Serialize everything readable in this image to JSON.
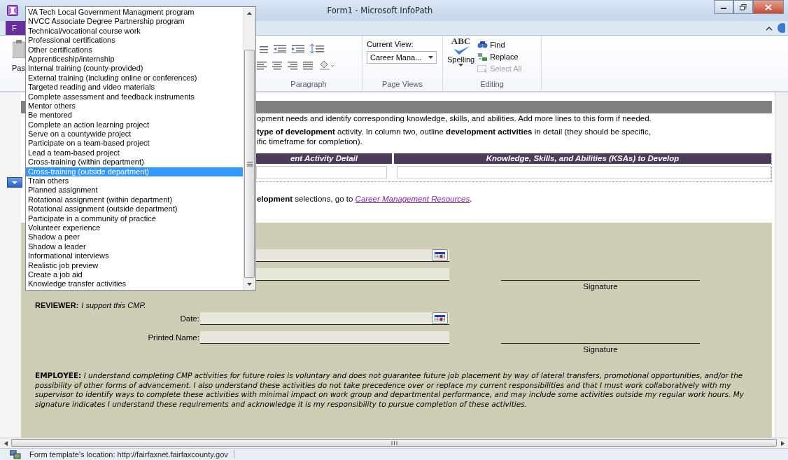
{
  "window": {
    "title": "Form1  -  Microsoft InfoPath"
  },
  "ribbon": {
    "file_tab": "F",
    "paste_label": "Pas",
    "groups": [
      {
        "kind": "paragraph",
        "label": "Paragraph"
      },
      {
        "kind": "views",
        "label": "Page Views"
      },
      {
        "kind": "editing",
        "label": "Editing"
      }
    ],
    "current_view": {
      "label": "Current View:",
      "value": "Career Mana..."
    },
    "spelling": {
      "logo": "ABC",
      "label": "Spelling"
    },
    "editing": [
      {
        "kind": "find",
        "label": "Find",
        "disabled": false
      },
      {
        "kind": "replace",
        "label": "Replace",
        "disabled": false
      },
      {
        "kind": "select",
        "label": "Select All",
        "disabled": true
      }
    ]
  },
  "dropdown": {
    "items": [
      {
        "label": "VA Tech Local Government Managment program",
        "selected": false
      },
      {
        "label": "NVCC Associate Degree Partnership program",
        "selected": false
      },
      {
        "label": "Technical/vocational course work",
        "selected": false
      },
      {
        "label": "Professional certifications",
        "selected": false
      },
      {
        "label": "Other certifications",
        "selected": false
      },
      {
        "label": "Apprenticeship/internship",
        "selected": false
      },
      {
        "label": "Internal training (county-provided)",
        "selected": false
      },
      {
        "label": "External training (including online or conferences)",
        "selected": false
      },
      {
        "label": "Targeted reading and video materials",
        "selected": false
      },
      {
        "label": "Complete assessment and feedback instruments",
        "selected": false
      },
      {
        "label": "Mentor others",
        "selected": false
      },
      {
        "label": "Be mentored",
        "selected": false
      },
      {
        "label": "Complete an action learning project",
        "selected": false
      },
      {
        "label": "Serve on a countywide project",
        "selected": false
      },
      {
        "label": "Participate on a team-based project",
        "selected": false
      },
      {
        "label": "Lead a team-based project",
        "selected": false
      },
      {
        "label": "Cross-training (within department)",
        "selected": false
      },
      {
        "label": "Cross-training (outside department)",
        "selected": true
      },
      {
        "label": "Train others",
        "selected": false
      },
      {
        "label": "Planned assignment",
        "selected": false
      },
      {
        "label": "Rotational assignment (within department)",
        "selected": false
      },
      {
        "label": "Rotational assignment (outside department)",
        "selected": false
      },
      {
        "label": "Participate in a community of practice",
        "selected": false
      },
      {
        "label": "Volunteer experience",
        "selected": false
      },
      {
        "label": "Shadow a peer",
        "selected": false
      },
      {
        "label": "Shadow a leader",
        "selected": false
      },
      {
        "label": "Informational interviews",
        "selected": false
      },
      {
        "label": "Realistic job preview",
        "selected": false
      },
      {
        "label": "Create a job aid",
        "selected": false
      },
      {
        "label": "Knowledge transfer activities",
        "selected": false
      }
    ]
  },
  "form": {
    "intro": [
      "opment needs and identify corresponding knowledge, skills, and abilities. Add more lines to this form if needed.",
      "**type of development** activity. In column two, outline **development activities** in detail (they should be specific,",
      "ific timeframe for completion)."
    ],
    "table": {
      "columns": [
        "ent Activity Detail",
        "Knowledge, Skills, and Abilities (KSAs) to Develop"
      ]
    },
    "resources": {
      "text": "**elopment** selections, go to ",
      "link": "Career Management Resources",
      "after": "."
    },
    "signers": [
      {
        "fields": [
          {
            "kind": "date"
          },
          {
            "kind": "text"
          }
        ],
        "signature_label": "Signature"
      },
      {
        "heading": "REVIEWER:",
        "statement": "I support this CMP.",
        "fields": [
          {
            "kind": "date",
            "label": "Date:"
          },
          {
            "kind": "text",
            "label": "Printed Name:"
          }
        ],
        "signature_label": "Signature"
      }
    ],
    "employee_statement": "**EMPLOYEE:**  *I understand completing CMP activities for future roles is voluntary and does not guarantee future job placement by way of lateral transfers, promotional opportunities, and/or the possibility of other forms of advancement.  I also understand these activities do not take precedence over or replace my current responsibilities and that I must work collaboratively with my supervisor to identify ways to complete these activities with minimal impact on work group and departmental performance, and may include some activities outside my regular work hours. My signature indicates I understand these requirements and acknowledge it is my responsibility to pursue completion of these activities.*"
  },
  "status_bar": {
    "text": "Form template's location: http://fairfaxnet.fairfaxcounty.gov"
  }
}
